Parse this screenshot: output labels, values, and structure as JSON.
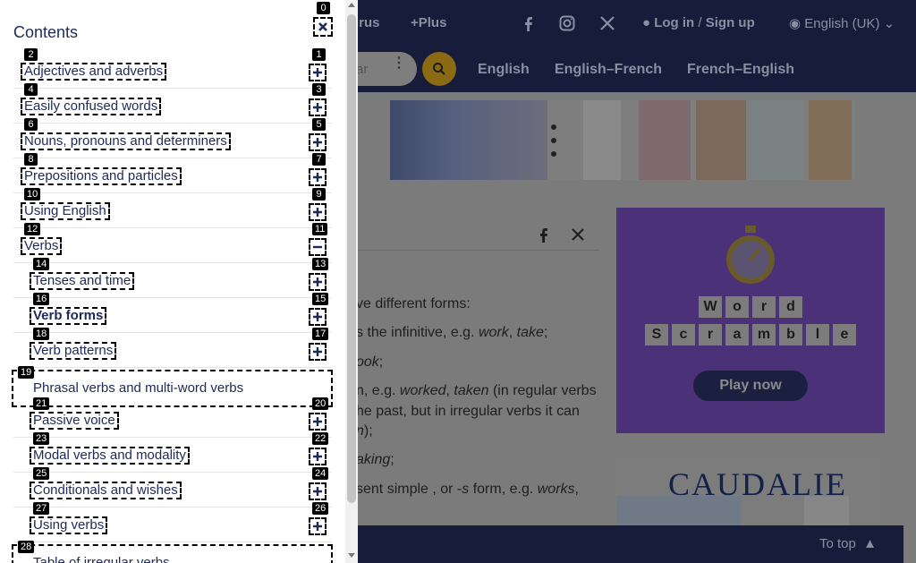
{
  "header": {
    "thesaurus_fragment": "urus",
    "plus_label": "+Plus",
    "login_label": "Log in",
    "slash": "/",
    "signup_label": "Sign up",
    "language_label": "English (UK)"
  },
  "nav": {
    "search_placeholder_fragment": "ar",
    "links": [
      "English",
      "English–French",
      "French–English"
    ]
  },
  "article": {
    "line1": "ve different forms:",
    "line2_pre": "s the infinitive, e.g. ",
    "line2_em1": "work",
    "line2_sep": ", ",
    "line2_em2": "take",
    "line2_end": ";",
    "line3_em": "ook",
    "line3_end": ";",
    "line4_pre": "n, e.g. ",
    "line4_em1": "worked",
    "line4_sep": ", ",
    "line4_em2": "taken",
    "line4_post": " (in regular verbs",
    "line5": "he past, but in irregular verbs it can",
    "line6_em": "n",
    "line6_end": ");",
    "line7_em": "aking",
    "line7_end": ";",
    "line8_pre": "sent simple , or -",
    "line8_em1": "s",
    "line8_mid": " form, e.g. ",
    "line8_em2": "works",
    "line8_end": ","
  },
  "ads": {
    "wordscramble_row1": [
      "W",
      "o",
      "r",
      "d"
    ],
    "wordscramble_row2": [
      "S",
      "c",
      "r",
      "a",
      "m",
      "b",
      "l",
      "e"
    ],
    "play_label": "Play now",
    "caudalie_brand": "CAUDALIE"
  },
  "footer": {
    "to_top_label": "To top"
  },
  "panel": {
    "title": "Contents",
    "close_badge": "0",
    "items": [
      {
        "label": "Adjectives and adverbs",
        "label_badge": "2",
        "toggle_badge": "1",
        "toggle": "plus",
        "level": 0
      },
      {
        "label": "Easily confused words",
        "label_badge": "4",
        "toggle_badge": "3",
        "toggle": "plus",
        "level": 0
      },
      {
        "label": "Nouns, pronouns and determiners",
        "label_badge": "6",
        "toggle_badge": "5",
        "toggle": "plus",
        "level": 0
      },
      {
        "label": "Prepositions and particles",
        "label_badge": "8",
        "toggle_badge": "7",
        "toggle": "plus",
        "level": 0
      },
      {
        "label": "Using English",
        "label_badge": "10",
        "toggle_badge": "9",
        "toggle": "plus",
        "level": 0
      },
      {
        "label": "Verbs",
        "label_badge": "12",
        "toggle_badge": "11",
        "toggle": "minus",
        "level": 0
      },
      {
        "label": "Tenses and time",
        "label_badge": "14",
        "toggle_badge": "13",
        "toggle": "plus",
        "level": 1
      },
      {
        "label": "Verb forms",
        "label_badge": "16",
        "toggle_badge": "15",
        "toggle": "plus",
        "level": 1,
        "bold": true
      },
      {
        "label": "Verb patterns",
        "label_badge": "18",
        "toggle_badge": "17",
        "toggle": "plus",
        "level": 1
      },
      {
        "label": "Phrasal verbs and multi-word verbs",
        "label_badge": "19",
        "toggle_badge": "",
        "toggle": "none",
        "level": 1,
        "full": true
      },
      {
        "label": "Passive voice",
        "label_badge": "21",
        "toggle_badge": "20",
        "toggle": "plus",
        "level": 1
      },
      {
        "label": "Modal verbs and modality",
        "label_badge": "23",
        "toggle_badge": "22",
        "toggle": "plus",
        "level": 1
      },
      {
        "label": "Conditionals and wishes",
        "label_badge": "25",
        "toggle_badge": "24",
        "toggle": "plus",
        "level": 1
      },
      {
        "label": "Using verbs",
        "label_badge": "27",
        "toggle_badge": "26",
        "toggle": "plus",
        "level": 1
      },
      {
        "label": "Table of irregular verbs",
        "label_badge": "28",
        "toggle_badge": "",
        "toggle": "none",
        "level": 1,
        "full": true
      }
    ]
  },
  "colors": {
    "panel_text": "#1d2a57",
    "header_bg": "#161c3a",
    "overlay": "#7b7b7b",
    "search_button": "#8a6a12"
  }
}
